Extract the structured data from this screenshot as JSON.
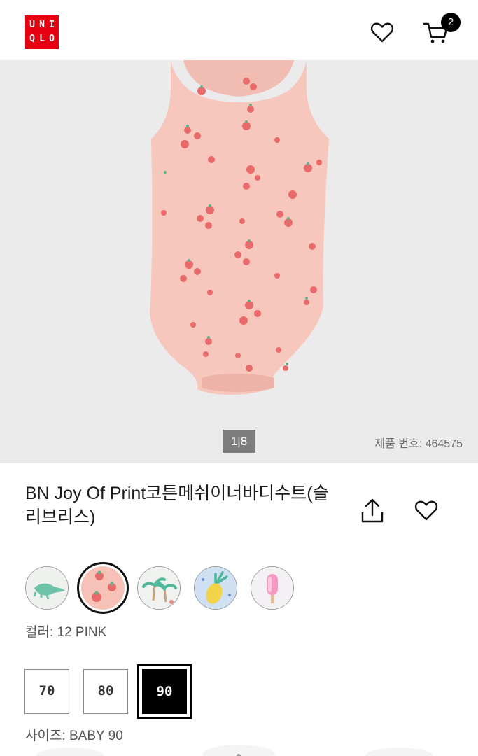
{
  "header": {
    "logo_letters": [
      "U",
      "N",
      "I",
      "Q",
      "L",
      "O"
    ],
    "cart_count": "2",
    "brand_color": "#e60012"
  },
  "hero": {
    "pager": "1|8",
    "product_number": "제품 번호: 464575"
  },
  "product": {
    "title": "BN Joy Of Print코튼메쉬이너바디수트(슬리브리스)"
  },
  "colors": {
    "swatches": [
      {
        "name": "crocodile",
        "selected": false
      },
      {
        "name": "strawberry",
        "selected": true
      },
      {
        "name": "palm-tree",
        "selected": false
      },
      {
        "name": "pineapple",
        "selected": false
      },
      {
        "name": "popsicle",
        "selected": false
      }
    ],
    "label": "컬러: 12 PINK"
  },
  "sizes": {
    "options": [
      "70",
      "80",
      "90"
    ],
    "selected": "90",
    "label": "사이즈: BABY 90"
  },
  "icons": {
    "wishlist": "heart-icon",
    "cart": "cart-icon",
    "share": "share-icon"
  }
}
